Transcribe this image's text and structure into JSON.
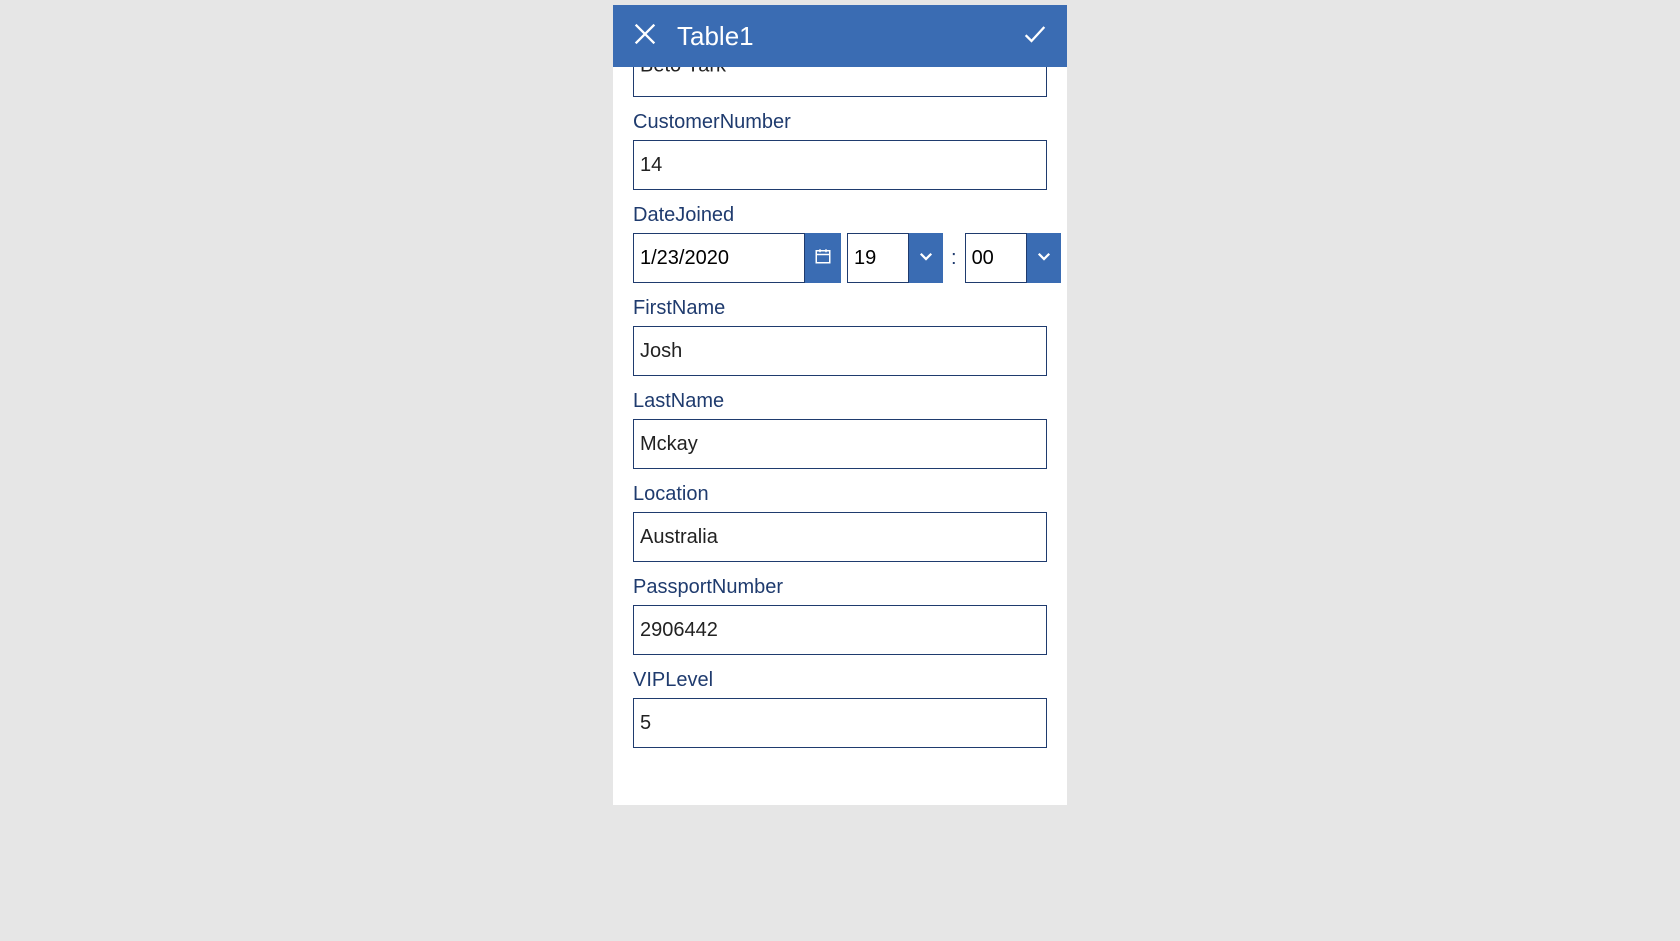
{
  "header": {
    "title": "Table1"
  },
  "form": {
    "topCut": {
      "value": "Beto Yark"
    },
    "customerNumber": {
      "label": "CustomerNumber",
      "value": "14"
    },
    "dateJoined": {
      "label": "DateJoined",
      "date": "1/23/2020",
      "hour": "19",
      "minute": "00"
    },
    "firstName": {
      "label": "FirstName",
      "value": "Josh"
    },
    "lastName": {
      "label": "LastName",
      "value": "Mckay"
    },
    "location": {
      "label": "Location",
      "value": "Australia"
    },
    "passportNumber": {
      "label": "PassportNumber",
      "value": "2906442"
    },
    "vipLevel": {
      "label": "VIPLevel",
      "value": "5"
    }
  }
}
